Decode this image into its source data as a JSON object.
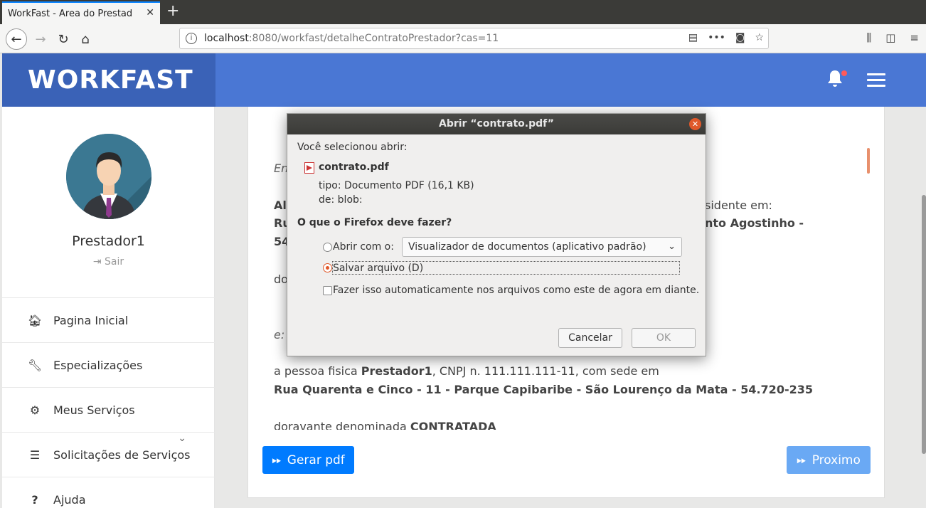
{
  "browser": {
    "tab_title": "WorkFast - Area do Prestad",
    "url_host": "localhost",
    "url_rest": ":8080/workfast/detalheContratoPrestador?cas=11"
  },
  "app": {
    "brand": "WORKFAST"
  },
  "sidebar": {
    "user_name": "Prestador1",
    "logout_label": "Sair",
    "items": [
      {
        "label": "Pagina Inicial",
        "icon": "home-icon"
      },
      {
        "label": "Especializações",
        "icon": "wrench-icon"
      },
      {
        "label": "Meus Serviços",
        "icon": "gears-icon"
      },
      {
        "label": "Solicitações de Serviços",
        "icon": "list-icon"
      },
      {
        "label": "Ajuda",
        "icon": "question-icon"
      }
    ]
  },
  "contract": {
    "line_em": "En",
    "line_al": "Al",
    "line_al_right": "sidente em:",
    "line_ru": "Ru",
    "line_ru_right": "nto Agostinho -",
    "line_54": "54",
    "line_do": "do",
    "line_e": "e:",
    "line_pf_a": "a pessoa fisica ",
    "line_pf_b": "Prestador1",
    "line_pf_c": ", CNPJ n. 111.111.111-11, com sede em",
    "address": "Rua Quarenta e Cinco - 11 - Parque Capibaribe - São Lourenço da Mata - 54.720-235",
    "line_doravante_a": "doravante denominada ",
    "line_doravante_b": "CONTRATADA"
  },
  "buttons": {
    "gerar_pdf": "Gerar pdf",
    "proximo": "Proximo"
  },
  "dialog": {
    "title": "Abrir “contrato.pdf”",
    "selected_label": "Você selecionou abrir:",
    "file_name": "contrato.pdf",
    "type_label": "tipo:",
    "type_value": "Documento PDF (16,1 KB)",
    "from_label": "de:",
    "from_value": "blob:",
    "question": "O que o Firefox deve fazer?",
    "open_with_label": "Abrir com o:",
    "open_with_value": "Visualizador de documentos (aplicativo padrão)",
    "save_label": "Salvar arquivo (D)",
    "auto_label": "Fazer isso automaticamente nos arquivos como este de agora em diante.",
    "cancel": "Cancelar",
    "ok": "OK"
  },
  "colors": {
    "header_blue": "#4a77d4",
    "brand_blue": "#3a62b7",
    "primary_button": "#007bff",
    "radio_accent": "#e0582a"
  }
}
